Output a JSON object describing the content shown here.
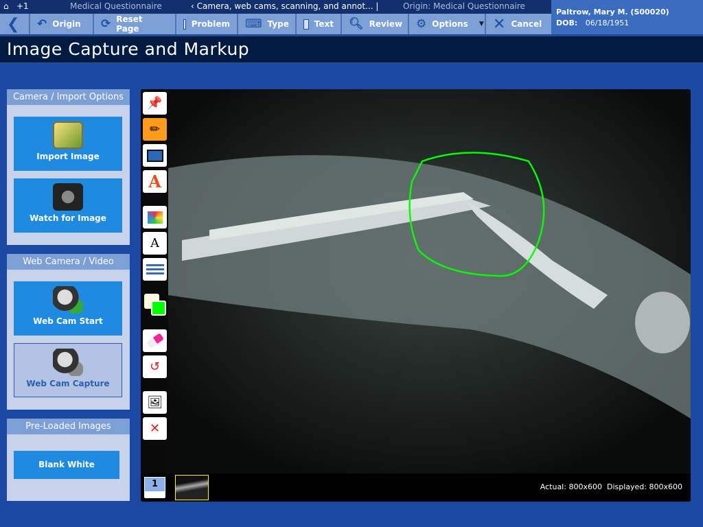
{
  "topbar": {
    "home_count": "+1",
    "form": "Medical Questionnaire",
    "page": "‹ Camera, web cams, scanning, and annot... |",
    "origin": "Origin: Medical Questionnaire"
  },
  "toolbar": {
    "origin": "Origin",
    "reset": "Reset Page",
    "problem": "Problem",
    "type": "Type",
    "text": "Text",
    "review": "Review",
    "options": "Options",
    "cancel": "Cancel"
  },
  "patient": {
    "name": "Paltrow, Mary M. (S00020)",
    "dob_label": "DOB:",
    "dob": "06/18/1951"
  },
  "title": "Image Capture and Markup",
  "panels": {
    "camera": {
      "header": "Camera / Import Options",
      "import": "Import Image",
      "watch": "Watch for Image"
    },
    "webcam": {
      "header": "Web Camera / Video",
      "start": "Web Cam Start",
      "capture": "Web Cam Capture"
    },
    "preloaded": {
      "header": "Pre-Loaded Images",
      "blank": "Blank White"
    }
  },
  "viewer": {
    "page_number": "1",
    "actual_label": "Actual:",
    "actual": "800x600",
    "displayed_label": "Displayed:",
    "displayed": "800x600",
    "pen_color": "#00ff00",
    "fill_color": "#fffde0"
  }
}
